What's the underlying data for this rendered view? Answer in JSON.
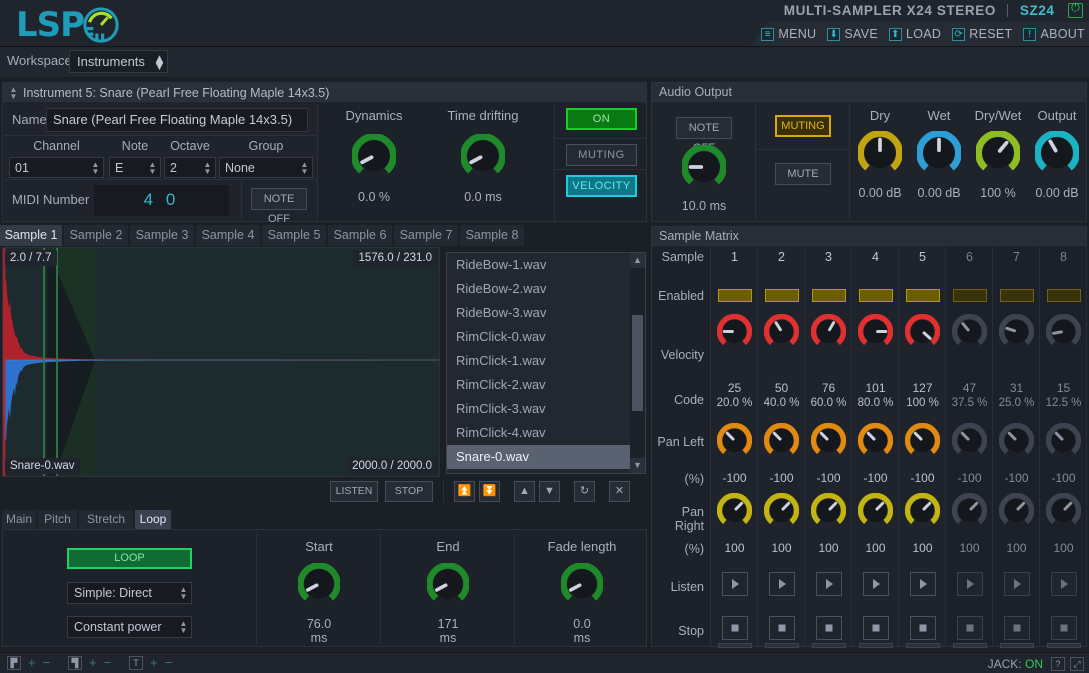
{
  "header": {
    "logo_text": "LSP",
    "logo_icon": "knob-logo-icon",
    "title_main": "MULTI-SAMPLER X24 STEREO",
    "title_code": "SZ24",
    "power_icon": "power-icon",
    "menu": [
      {
        "label": "MENU",
        "icon": "hamburger-icon",
        "glyph": "≡"
      },
      {
        "label": "SAVE",
        "icon": "download-icon",
        "glyph": "⬇"
      },
      {
        "label": "LOAD",
        "icon": "upload-icon",
        "glyph": "⬆"
      },
      {
        "label": "RESET",
        "icon": "reset-icon",
        "glyph": "⟳"
      },
      {
        "label": "ABOUT",
        "icon": "info-icon",
        "glyph": "!"
      }
    ]
  },
  "workspace": {
    "label": "Workspace",
    "selected": "Instruments"
  },
  "instrument": {
    "header": "Instrument 5: Snare (Pearl Free Floating Maple 14x3.5)",
    "name_label": "Name",
    "name_value": "Snare (Pearl Free Floating Maple 14x3.5)",
    "selectors": [
      {
        "label": "Channel",
        "value": "01"
      },
      {
        "label": "Note",
        "value": "E"
      },
      {
        "label": "Octave",
        "value": "2"
      },
      {
        "label": "Group",
        "value": "None"
      }
    ],
    "midi_label": "MIDI Number",
    "midi_value": "4 0",
    "note_off_label": "NOTE OFF",
    "knobs": [
      {
        "label": "Dynamics",
        "value": "0.0 %",
        "color": "#1f8a2a",
        "angle": -118
      },
      {
        "label": "Time drifting",
        "value": "0.0 ms",
        "color": "#1f8a2a",
        "angle": -118
      }
    ],
    "buttons": [
      {
        "label": "ON",
        "state": "active-green"
      },
      {
        "label": "MUTING",
        "state": "inactive"
      },
      {
        "label": "VELOCITY",
        "state": "active-cyan"
      }
    ]
  },
  "audio_output": {
    "title": "Audio Output",
    "note_off_label": "NOTE OFF",
    "release_value": "10.0 ms",
    "release_color": "#1f8a2a",
    "muting_label": "MUTING",
    "mute_label": "MUTE",
    "knobs": [
      {
        "label": "Dry",
        "value": "0.00 dB",
        "color": "#c2a312",
        "angle": 0
      },
      {
        "label": "Wet",
        "value": "0.00 dB",
        "color": "#2e9ed6",
        "angle": 0
      },
      {
        "label": "Dry/Wet",
        "value": "100 %",
        "color": "#8fbe22",
        "angle": 40
      },
      {
        "label": "Output",
        "value": "0.00 dB",
        "color": "#1ab3c4",
        "angle": -30
      }
    ]
  },
  "sample_tabs": [
    {
      "label": "Sample 1",
      "active": true
    },
    {
      "label": "Sample 2",
      "active": false
    },
    {
      "label": "Sample 3",
      "active": false
    },
    {
      "label": "Sample 4",
      "active": false
    },
    {
      "label": "Sample 5",
      "active": false
    },
    {
      "label": "Sample 6",
      "active": false
    },
    {
      "label": "Sample 7",
      "active": false
    },
    {
      "label": "Sample 8",
      "active": false
    }
  ],
  "waveform": {
    "top_left": "2.0 / 7.7",
    "top_right": "1576.0 / 231.0",
    "bottom_left": "Snare-0.wav",
    "bottom_right": "2000.0 / 2000.0"
  },
  "file_list": {
    "items": [
      "RideBow-1.wav",
      "RideBow-2.wav",
      "RideBow-3.wav",
      "RimClick-0.wav",
      "RimClick-1.wav",
      "RimClick-2.wav",
      "RimClick-3.wav",
      "RimClick-4.wav",
      "Snare-0.wav"
    ],
    "selected_index": 8,
    "scroll_up_icon": "triangle-up-icon",
    "scroll_down_icon": "triangle-down-icon"
  },
  "transport": {
    "listen_label": "LISTEN",
    "stop_label": "STOP",
    "icon_buttons": [
      {
        "icon": "collapse-top-icon",
        "glyph": "⏫"
      },
      {
        "icon": "collapse-bottom-icon",
        "glyph": "⏬"
      },
      {
        "icon": "move-up-icon",
        "glyph": "▲"
      },
      {
        "icon": "move-down-icon",
        "glyph": "▼"
      },
      {
        "icon": "reload-icon",
        "glyph": "↻"
      },
      {
        "icon": "clear-icon",
        "glyph": "✕"
      }
    ]
  },
  "sub_tabs": [
    {
      "label": "Main",
      "active": false
    },
    {
      "label": "Pitch",
      "active": false
    },
    {
      "label": "Stretch",
      "active": false
    },
    {
      "label": "Loop",
      "active": true
    }
  ],
  "loop": {
    "loop_button": "LOOP",
    "mode": "Simple: Direct",
    "fade_mode": "Constant power",
    "knobs": [
      {
        "label": "Start",
        "value": "76.0",
        "unit": "ms",
        "color": "#1f8a2a",
        "angle": -118
      },
      {
        "label": "End",
        "value": "171",
        "unit": "ms",
        "color": "#1f8a2a",
        "angle": -118
      },
      {
        "label": "Fade length",
        "value": "0.0",
        "unit": "ms",
        "color": "#1f8a2a",
        "angle": -118
      }
    ]
  },
  "sample_matrix": {
    "title": "Sample Matrix",
    "row_labels": {
      "sample": "Sample",
      "enabled": "Enabled",
      "velocity": "Velocity",
      "code": "Code",
      "pan_left": "Pan Left",
      "pan_left_unit": "(%)",
      "pan_right": "Pan Right",
      "pan_right_unit": "(%)",
      "listen": "Listen",
      "stop": "Stop"
    },
    "listen_icon": "play-icon",
    "stop_icon": "stop-icon",
    "columns": [
      {
        "num": "1",
        "enabled": true,
        "active": true,
        "velocity_code": "25",
        "velocity_pct": "20.0 %",
        "velocity_angle": -90,
        "pan_left": "-100",
        "pan_right": "100"
      },
      {
        "num": "2",
        "enabled": true,
        "active": true,
        "velocity_code": "50",
        "velocity_pct": "40.0 %",
        "velocity_angle": -32,
        "pan_left": "-100",
        "pan_right": "100"
      },
      {
        "num": "3",
        "enabled": true,
        "active": true,
        "velocity_code": "76",
        "velocity_pct": "60.0 %",
        "velocity_angle": 30,
        "pan_left": "-100",
        "pan_right": "100"
      },
      {
        "num": "4",
        "enabled": true,
        "active": true,
        "velocity_code": "101",
        "velocity_pct": "80.0 %",
        "velocity_angle": 90,
        "pan_left": "-100",
        "pan_right": "100"
      },
      {
        "num": "5",
        "enabled": true,
        "active": true,
        "velocity_code": "127",
        "velocity_pct": "100 %",
        "velocity_angle": 132,
        "pan_left": "-100",
        "pan_right": "100"
      },
      {
        "num": "6",
        "enabled": true,
        "active": false,
        "velocity_code": "47",
        "velocity_pct": "37.5 %",
        "velocity_angle": -40,
        "pan_left": "-100",
        "pan_right": "100"
      },
      {
        "num": "7",
        "enabled": true,
        "active": false,
        "velocity_code": "31",
        "velocity_pct": "25.0 %",
        "velocity_angle": -72,
        "pan_left": "-100",
        "pan_right": "100"
      },
      {
        "num": "8",
        "enabled": true,
        "active": false,
        "velocity_code": "15",
        "velocity_pct": "12.5 %",
        "velocity_angle": -100,
        "pan_left": "-100",
        "pan_right": "100"
      }
    ],
    "pan_left_color": "#e08a12",
    "pan_right_color": "#c2b512",
    "velocity_color": "#e03030",
    "dim_color": "#5b626f"
  },
  "status_bar": {
    "groups": [
      {
        "icon": "panel-left-icon",
        "plus": "+",
        "minus": "−"
      },
      {
        "icon": "panel-split-icon",
        "plus": "+",
        "minus": "−"
      },
      {
        "icon": "text-icon",
        "plus": "+",
        "minus": "−"
      }
    ],
    "jack_label": "JACK:",
    "jack_value": "ON",
    "help_icon": "question-icon",
    "resize_icon": "resize-icon"
  },
  "colors": {
    "bg": "#1b1f26",
    "panel": "#1d2129",
    "accent_cyan": "#1e9cb8",
    "accent_green": "#2ecc55"
  }
}
